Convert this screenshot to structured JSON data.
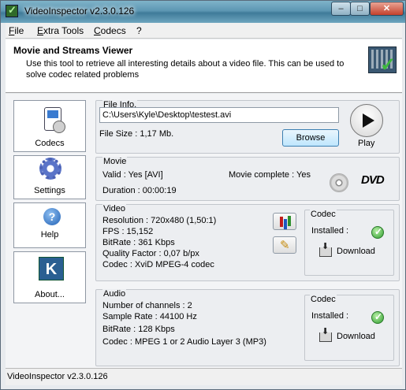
{
  "window": {
    "title": "VideoInspector v2.3.0.126",
    "min_label": "–",
    "max_label": "□",
    "close_label": "✕"
  },
  "menu": [
    {
      "label": "File",
      "accel": "F",
      "rest": "ile"
    },
    {
      "label": "Extra Tools",
      "accel": "E",
      "rest": "xtra Tools"
    },
    {
      "label": "Codecs",
      "accel": "C",
      "rest": "odecs"
    },
    {
      "label": "?",
      "accel": "",
      "rest": "?"
    }
  ],
  "header": {
    "title": "Movie and Streams Viewer",
    "description": "Use this tool to retrieve all interesting details about a video file. This can be used to solve codec related problems"
  },
  "sidebar": {
    "items": [
      {
        "label": "Codecs",
        "icon": "codecs-icon"
      },
      {
        "label": "Settings",
        "icon": "gear-icon"
      },
      {
        "label": "Help",
        "icon": "help-icon"
      },
      {
        "label": "About...",
        "icon": "about-icon"
      }
    ]
  },
  "file_info": {
    "title": "File Info.",
    "path": "C:\\Users\\Kyle\\Desktop\\testest.avi",
    "file_size": "File Size : 1,17 Mb.",
    "browse_label": "Browse",
    "play_label": "Play"
  },
  "movie": {
    "title": "Movie",
    "valid": "Valid : Yes [AVI]",
    "complete": "Movie complete : Yes",
    "duration": "Duration : 00:00:19",
    "dvd_label": "DVD"
  },
  "video": {
    "title": "Video",
    "resolution": "Resolution : 720x480 (1,50:1)",
    "fps": "FPS : 15,152",
    "bitrate": "BitRate : 361 Kbps",
    "quality": "Quality Factor : 0,07 b/px",
    "codec": "Codec : XviD MPEG-4 codec",
    "codec_box": {
      "title": "Codec",
      "installed": "Installed :",
      "download": "Download"
    }
  },
  "audio": {
    "title": "Audio",
    "channels": "Number of channels : 2",
    "sample_rate": "Sample Rate : 44100 Hz",
    "bitrate": "BitRate : 128 Kbps",
    "codec": "Codec : MPEG 1 or 2 Audio Layer 3 (MP3)",
    "codec_box": {
      "title": "Codec",
      "installed": "Installed :",
      "download": "Download"
    }
  },
  "status": {
    "text": "VideoInspector v2.3.0.126"
  },
  "colors": {
    "titlebar": "#5d97b3",
    "accent": "#3c7fb1",
    "check": "#2e9c2e"
  }
}
